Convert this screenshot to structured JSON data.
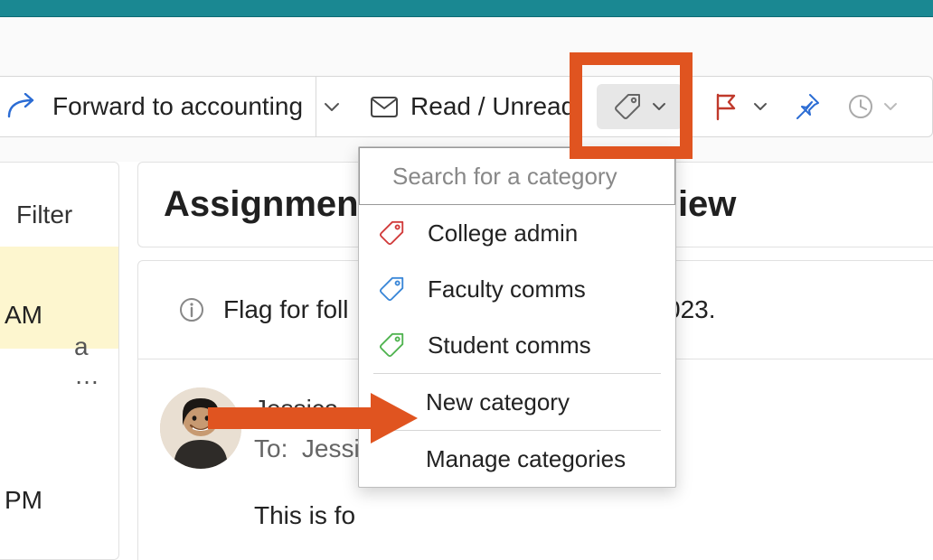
{
  "toolbar": {
    "forward_label": "Forward to accounting",
    "read_label": "Read / Unread"
  },
  "sidebar": {
    "filter_label": "Filter",
    "preview_line1": "AM",
    "preview_line2": "a …",
    "preview_line3": "PM"
  },
  "header": {
    "title_before": "Assignment",
    "title_after": "iew"
  },
  "message": {
    "flag_text": "Flag for foll",
    "flag_date": "023.",
    "sender_name": "Jessica",
    "to_prefix": "To:",
    "to_value": "Jessic",
    "body_text": "This is fo"
  },
  "dropdown": {
    "search_placeholder": "Search for a category",
    "items": [
      {
        "label": "College admin",
        "color": "#d13b3b"
      },
      {
        "label": "Faculty comms",
        "color": "#3a87d8"
      },
      {
        "label": "Student comms",
        "color": "#4fb34f"
      }
    ],
    "new_category_label": "New category",
    "manage_label": "Manage categories"
  }
}
